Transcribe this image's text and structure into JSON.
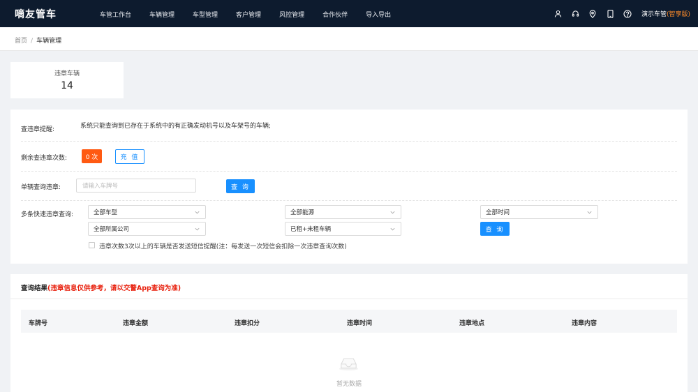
{
  "app": {
    "logo": "嘀友管车"
  },
  "nav": [
    "车管工作台",
    "车辆管理",
    "车型管理",
    "客户管理",
    "风控管理",
    "合作伙伴",
    "导入导出"
  ],
  "header_icons": [
    "user-icon",
    "headset-icon",
    "location-icon",
    "mobile-icon",
    "help-icon"
  ],
  "user": {
    "name": "演示车管",
    "edition": "(智享版)"
  },
  "breadcrumb": {
    "home": "首页",
    "sep": "/",
    "current": "车辆管理"
  },
  "stat": {
    "label": "违章车辆",
    "value": "14"
  },
  "reminder": {
    "label": "查违章提醒:",
    "text": "系统只能查询到已存在于系统中的有正确发动机号以及车架号的车辆;"
  },
  "remaining": {
    "label": "剩余查违章次数:",
    "count": "0 次",
    "recharge": "充 值"
  },
  "single": {
    "label": "单辆查询违章:",
    "placeholder": "请输入车牌号",
    "button": "查 询"
  },
  "multi": {
    "label": "多条快速违章查询:",
    "vehicle_type": "全部车型",
    "energy": "全部能源",
    "time": "全部时间",
    "company": "全部所属公司",
    "rent_status": "已租+未租车辆",
    "button": "查 询"
  },
  "sms": {
    "label": "违章次数3次以上的车辆是否发送短信提醒(注：每发送一次短信会扣除一次违章查询次数)",
    "checked": false
  },
  "results": {
    "title": "查询结果",
    "note": "(违章信息仅供参考，请以交警App查询为准)",
    "columns": [
      "车牌号",
      "违章金额",
      "违章扣分",
      "违章时间",
      "违章地点",
      "违章内容"
    ],
    "empty": "暂无数据"
  },
  "colors": {
    "topbar": "#0d1b2e",
    "primary": "#1890ff",
    "badge": "#ff5a12",
    "edition": "#ff8c2a",
    "warning": "#e8200d"
  }
}
